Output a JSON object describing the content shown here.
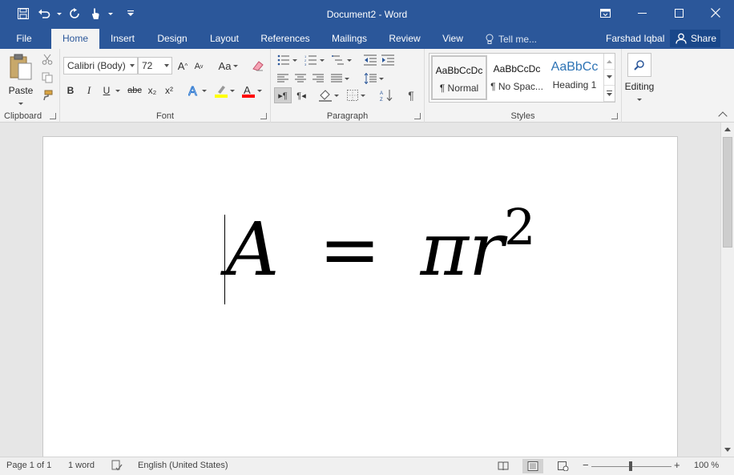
{
  "window": {
    "title": "Document2 - Word"
  },
  "tabs": [
    {
      "label": "File"
    },
    {
      "label": "Home"
    },
    {
      "label": "Insert"
    },
    {
      "label": "Design"
    },
    {
      "label": "Layout"
    },
    {
      "label": "References"
    },
    {
      "label": "Mailings"
    },
    {
      "label": "Review"
    },
    {
      "label": "View"
    }
  ],
  "tellme": {
    "placeholder": "Tell me..."
  },
  "account": {
    "user": "Farshad Iqbal",
    "share_label": "Share"
  },
  "ribbon": {
    "clipboard": {
      "label": "Clipboard",
      "paste_label": "Paste"
    },
    "font": {
      "label": "Font",
      "font_name": "Calibri (Body)",
      "font_size": "72",
      "bold": "B",
      "italic": "I",
      "underline": "U",
      "strike": "abc",
      "subscript": "x₂",
      "superscript": "x²",
      "grow": "A",
      "shrink": "A",
      "case": "Aa"
    },
    "paragraph": {
      "label": "Paragraph"
    },
    "styles": {
      "label": "Styles",
      "items": [
        {
          "sample": "AaBbCcDc",
          "name": "¶ Normal",
          "selected": true
        },
        {
          "sample": "AaBbCcDc",
          "name": "¶ No Spac...",
          "selected": false
        },
        {
          "sample": "AaBbCc",
          "name": "Heading 1",
          "selected": false
        }
      ]
    },
    "editing": {
      "label": "Editing"
    }
  },
  "document": {
    "equation": {
      "lhs": "A",
      "eq": "=",
      "rhs": "πr",
      "exp": "2"
    }
  },
  "status": {
    "page": "Page 1 of 1",
    "words": "1 word",
    "language": "English (United States)",
    "zoom": "100 %",
    "zoom_minus": "−",
    "zoom_plus": "+"
  },
  "colors": {
    "accent": "#2b579a",
    "highlight": "#ffff00",
    "font_color": "#ff0000"
  }
}
